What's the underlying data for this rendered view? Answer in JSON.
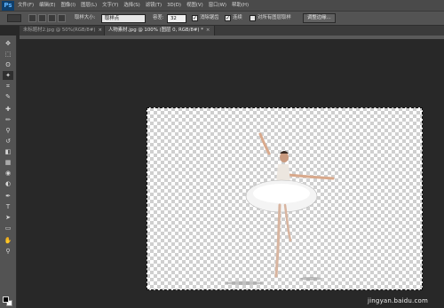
{
  "app": {
    "logo": "Ps"
  },
  "menubar": {
    "items": [
      "文件(F)",
      "编辑(E)",
      "图像(I)",
      "图层(L)",
      "文字(Y)",
      "选择(S)",
      "滤镜(T)",
      "3D(D)",
      "视图(V)",
      "窗口(W)",
      "帮助(H)"
    ]
  },
  "options": {
    "sample_size_label": "取样大小:",
    "sample_size_value": "取样点",
    "tolerance_label": "容差:",
    "tolerance_value": "32",
    "anti_alias_label": "消除锯齿",
    "contiguous_label": "连续",
    "sample_all_label": "对所有图层取样",
    "refine_edge_label": "调整边缘..."
  },
  "tabs": [
    {
      "label": "未标题材2.jpg @ 50%(RGB/8#)",
      "close": "×"
    },
    {
      "label": "人物素材.jpg @ 100% (图层 0, RGB/8#) *",
      "close": "×"
    }
  ],
  "tools": [
    "move-icon",
    "marquee-icon",
    "lasso-icon",
    "magic-wand-icon",
    "crop-icon",
    "eyedropper-icon",
    "healing-icon",
    "brush-icon",
    "stamp-icon",
    "history-brush-icon",
    "eraser-icon",
    "gradient-icon",
    "blur-icon",
    "dodge-icon",
    "pen-icon",
    "type-icon",
    "path-select-icon",
    "shape-icon",
    "hand-icon",
    "zoom-icon"
  ],
  "tool_glyphs": [
    "✥",
    "⬚",
    "ʘ",
    "✦",
    "⌗",
    "✎",
    "✚",
    "✏",
    "⚲",
    "↺",
    "◧",
    "▦",
    "◉",
    "◐",
    "✒",
    "T",
    "➤",
    "▭",
    "✋",
    "⚲"
  ],
  "watermark": "jingyan.baidu.com",
  "colors": {
    "menubar": "#4a4a4a",
    "options_bar": "#535353",
    "workspace": "#282828",
    "foreground": "#000000",
    "background": "#ffffff"
  }
}
